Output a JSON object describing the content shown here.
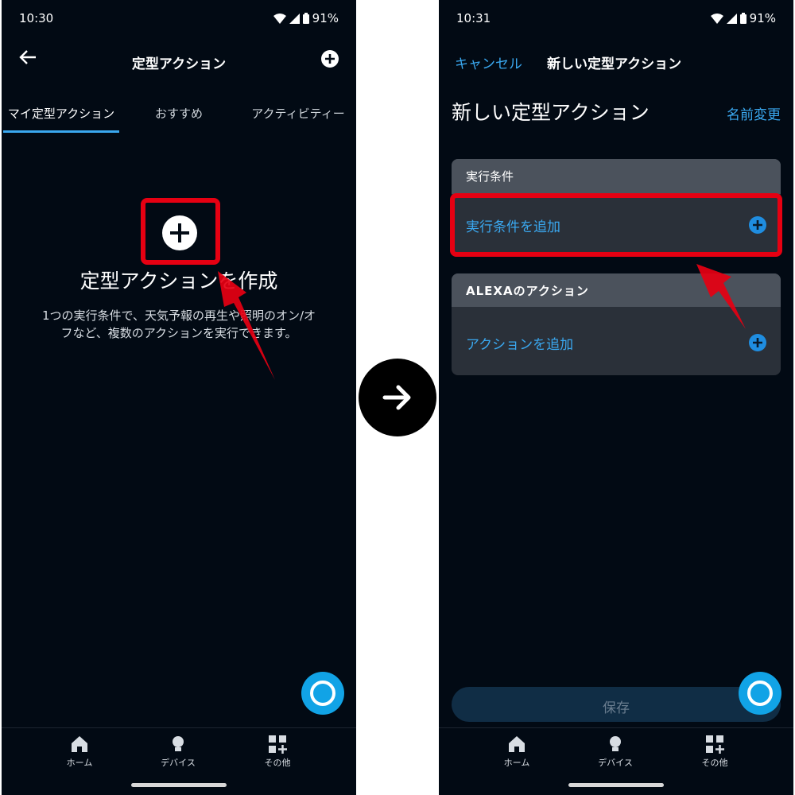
{
  "left": {
    "status": {
      "time": "10:30",
      "battery": "91%"
    },
    "header": {
      "title": "定型アクション"
    },
    "tabs": [
      {
        "label": "マイ定型アクション"
      },
      {
        "label": "おすすめ"
      },
      {
        "label": "アクティビティー"
      }
    ],
    "empty": {
      "title": "定型アクションを作成",
      "description_line1": "1つの実行条件で、天気予報の再生や照明のオン/オ",
      "description_line2": "フなど、複数のアクションを実行できます。"
    },
    "nav": {
      "home": "ホーム",
      "devices": "デバイス",
      "more": "その他"
    }
  },
  "right": {
    "status": {
      "time": "10:31",
      "battery": "91%"
    },
    "header": {
      "cancel": "キャンセル",
      "title": "新しい定型アクション"
    },
    "page_title": "新しい定型アクション",
    "rename": "名前変更",
    "trigger_section": {
      "header": "実行条件",
      "add_label": "実行条件を追加"
    },
    "action_section": {
      "header": "ALEXAのアクション",
      "add_label": "アクションを追加"
    },
    "save_label": "保存",
    "nav": {
      "home": "ホーム",
      "devices": "デバイス",
      "more": "その他"
    }
  },
  "colors": {
    "accent": "#3aa8f0",
    "annotation_red": "#e60012",
    "background": "#020a14",
    "alexa_blue": "#11a3e6"
  }
}
